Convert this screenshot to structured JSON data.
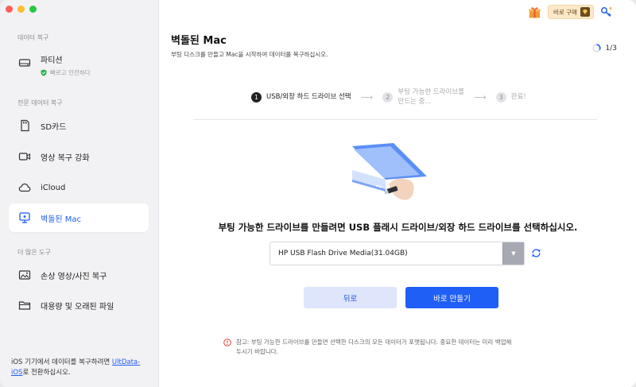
{
  "sidebar": {
    "sections": [
      "데이터 복구",
      "전문 데이터 복구",
      "더 많은 도구"
    ],
    "items": [
      {
        "label": "파티션",
        "sub": "빠르고 안전하다"
      },
      {
        "label": "SD카드"
      },
      {
        "label": "영상 복구 강화"
      },
      {
        "label": "iCloud"
      },
      {
        "label": "벽돌된 Mac"
      },
      {
        "label": "손상 영상/사진 복구"
      },
      {
        "label": "대용량 및 오래된 파일"
      }
    ],
    "footer": {
      "prefix": "iOS 기기에서 데이터를 복구하려면 ",
      "link_a": "UltData-",
      "link_b": "iOS",
      "suffix": "로 전환하십시오."
    }
  },
  "topbar": {
    "buy_label": "바로 구매"
  },
  "header": {
    "title": "벽돌된 Mac",
    "description": "부팅 디스크를 만들고 Mac을 시작하여 데이터를 복구하십시오.",
    "progress": "1/3"
  },
  "steps": [
    {
      "num": "1",
      "label": "USB/외장 하드 드라이브 선택"
    },
    {
      "num": "2",
      "label_line1": "부팅 가능한 드라이브를",
      "label_line2": "만드는 중..."
    },
    {
      "num": "3",
      "label": "완료!"
    }
  ],
  "main": {
    "headline": "부팅 가능한 드라이브를 만들려면 USB 플래시 드라이브/외장 하드 드라이브를 선택하십시오.",
    "drive_value": "HP USB Flash Drive Media(31.04GB)",
    "back_label": "뒤로",
    "create_label": "바로 만들기",
    "notice_line1": "참고: 부팅 가능한 드라이브를 만들면 선택한 디스크의 모든 데이터가 포맷됩니다. 중요한 데이터는 미리 백업해",
    "notice_line2": "두시기 바랍니다."
  },
  "colors": {
    "accent": "#1f5ff5",
    "active_text": "#1d5cf5",
    "sidebar_bg": "#f2f2f4"
  }
}
